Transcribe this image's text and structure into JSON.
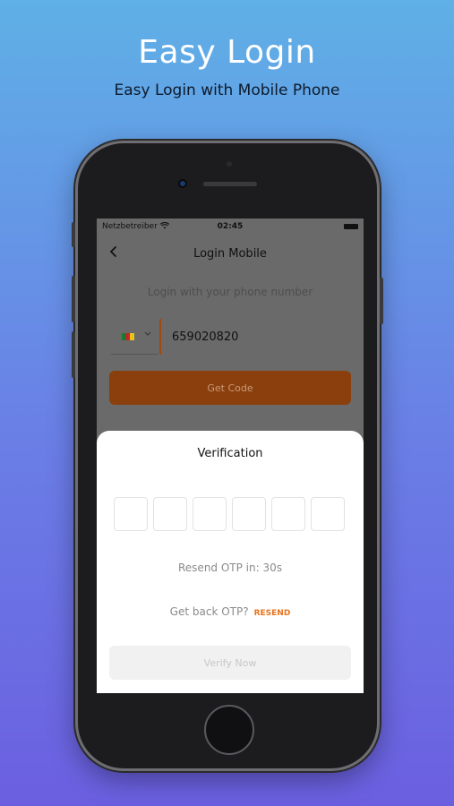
{
  "hero": {
    "title": "Easy Login",
    "subtitle": "Easy Login with Mobile Phone"
  },
  "status_bar": {
    "carrier": "Netzbetreiber",
    "time": "02:45"
  },
  "nav": {
    "title": "Login Mobile",
    "back_icon": "chevron-left-icon"
  },
  "login": {
    "prompt": "Login with your phone number",
    "country_flag": "cameroon-flag-icon",
    "phone_value": "659020820",
    "get_code_label": "Get Code"
  },
  "verification": {
    "title": "Verification",
    "otp_slots": 6,
    "resend_timer": "Resend OTP in: 30s",
    "get_back_text": "Get back OTP?",
    "resend_label": "RESEND",
    "verify_label": "Verify Now"
  },
  "colors": {
    "accent": "#e8731c",
    "background_top": "#5fb0e6",
    "background_bottom": "#6b5fe0"
  }
}
